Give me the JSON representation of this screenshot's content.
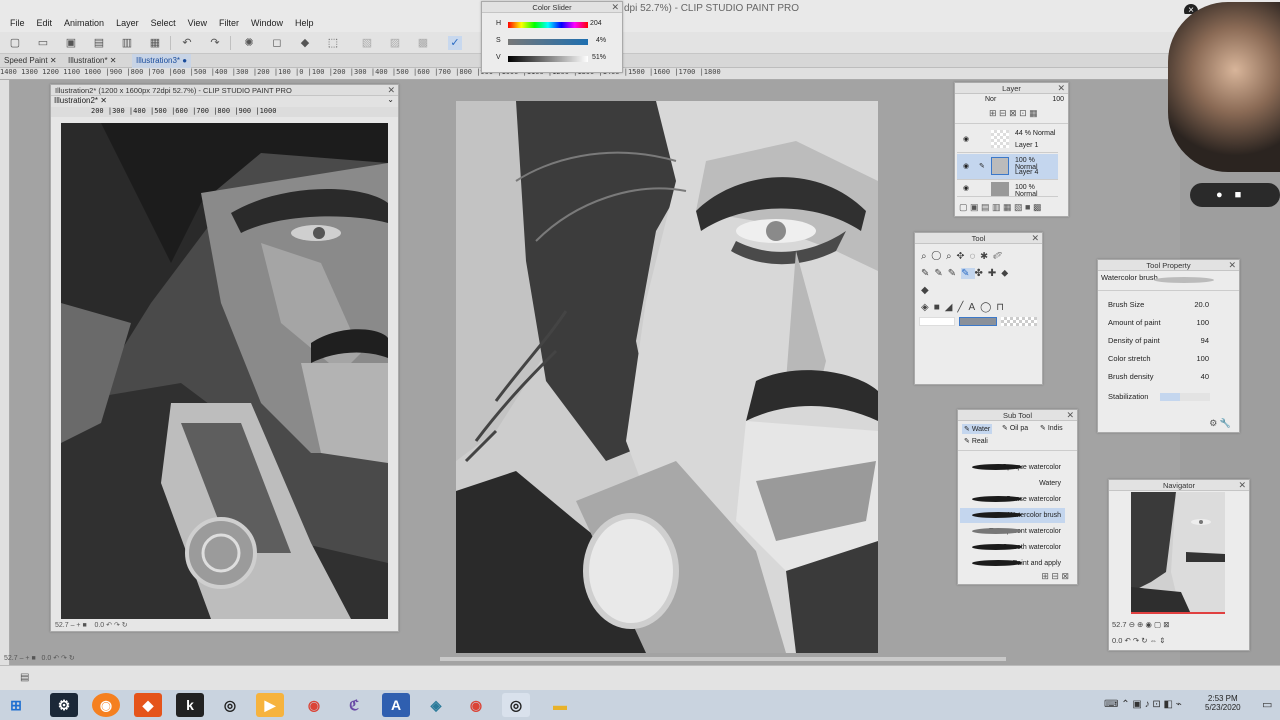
{
  "app": {
    "title": "dpi 52.7%) - CLIP STUDIO PAINT PRO"
  },
  "menu": [
    "File",
    "Edit",
    "Animation",
    "Layer",
    "Select",
    "View",
    "Filter",
    "Window",
    "Help"
  ],
  "tabs": [
    {
      "label": "Speed Paint",
      "active": false
    },
    {
      "label": "Illustration*",
      "active": false
    },
    {
      "label": "Illustration3*",
      "active": true
    }
  ],
  "ruler_top_text": "1400  1300  1200  1100  1000  |900  |800  |700  |600  |500  |400  |300  |200  |100  |0  |100  |200  |300  |400  |500  |600  |700  |800  |900  |1000  |1100  |1200  |1300  |1400  |1500  |1600  |1700  |1800",
  "ref_window": {
    "title": "Illustration2* (1200 x 1600px 72dpi 52.7%) - CLIP STUDIO PAINT PRO",
    "tab": "Illustration2*",
    "ruler": "200  |300  |400  |500  |600  |700  |800  |900  |1000",
    "zoom": "52.7",
    "angle": "0.0"
  },
  "color_slider": {
    "title": "Color Slider",
    "h_label": "H",
    "h_value": "204",
    "s_label": "S",
    "s_value": "4%",
    "v_label": "V",
    "v_value": "51%"
  },
  "layer_panel": {
    "title": "Layer",
    "blend": "Nor",
    "opacity": "100",
    "layers": [
      {
        "meta": "44 % Normal",
        "name": "Layer 1",
        "selected": false
      },
      {
        "meta": "100 % Normal",
        "name": "Layer 4",
        "selected": true
      },
      {
        "meta": "100 % Normal",
        "name": "",
        "selected": false
      }
    ]
  },
  "tool_panel": {
    "title": "Tool"
  },
  "sub_tool": {
    "title": "Sub Tool",
    "tabs": [
      "Water",
      "Oil pa",
      "Indis"
    ],
    "tab2": "Reali",
    "items": [
      {
        "label": "Opaque watercolor",
        "selected": false
      },
      {
        "label": "Watery",
        "selected": false
      },
      {
        "label": "Dense watercolor",
        "selected": false
      },
      {
        "label": "Watercolor brush",
        "selected": true
      },
      {
        "label": "Transparent watercolor",
        "selected": false
      },
      {
        "label": "Smooth watercolor",
        "selected": false
      },
      {
        "label": "Paint and apply",
        "selected": false
      }
    ]
  },
  "tool_property": {
    "title": "Tool Property",
    "brush_name": "Watercolor brush",
    "props": [
      {
        "label": "Brush Size",
        "value": "20.0"
      },
      {
        "label": "Amount of paint",
        "value": "100"
      },
      {
        "label": "Density of paint",
        "value": "94"
      },
      {
        "label": "Color stretch",
        "value": "100"
      },
      {
        "label": "Brush density",
        "value": "40"
      },
      {
        "label": "Stabilization",
        "value": ""
      }
    ]
  },
  "navigator": {
    "title": "Navigator",
    "zoom": "52.7",
    "angle": "0.0"
  },
  "status": {
    "zoom": "52.7",
    "angle": "0.0"
  },
  "clock": {
    "time": "2:53 PM",
    "date": "5/23/2020"
  },
  "colors": {
    "accent": "#3b78c9",
    "selection": "#c4d6ee",
    "panel": "#ececec"
  },
  "taskbar_icons": [
    "windows-start-icon",
    "steam-icon",
    "origin-icon",
    "brave-icon",
    "krita-icon",
    "obs-icon",
    "media-player-icon",
    "chrome-icon",
    "clip-studio-icon",
    "photoshop-icon",
    "app-icon",
    "chrome-icon-2",
    "obs-icon-2",
    "file-explorer-icon"
  ]
}
